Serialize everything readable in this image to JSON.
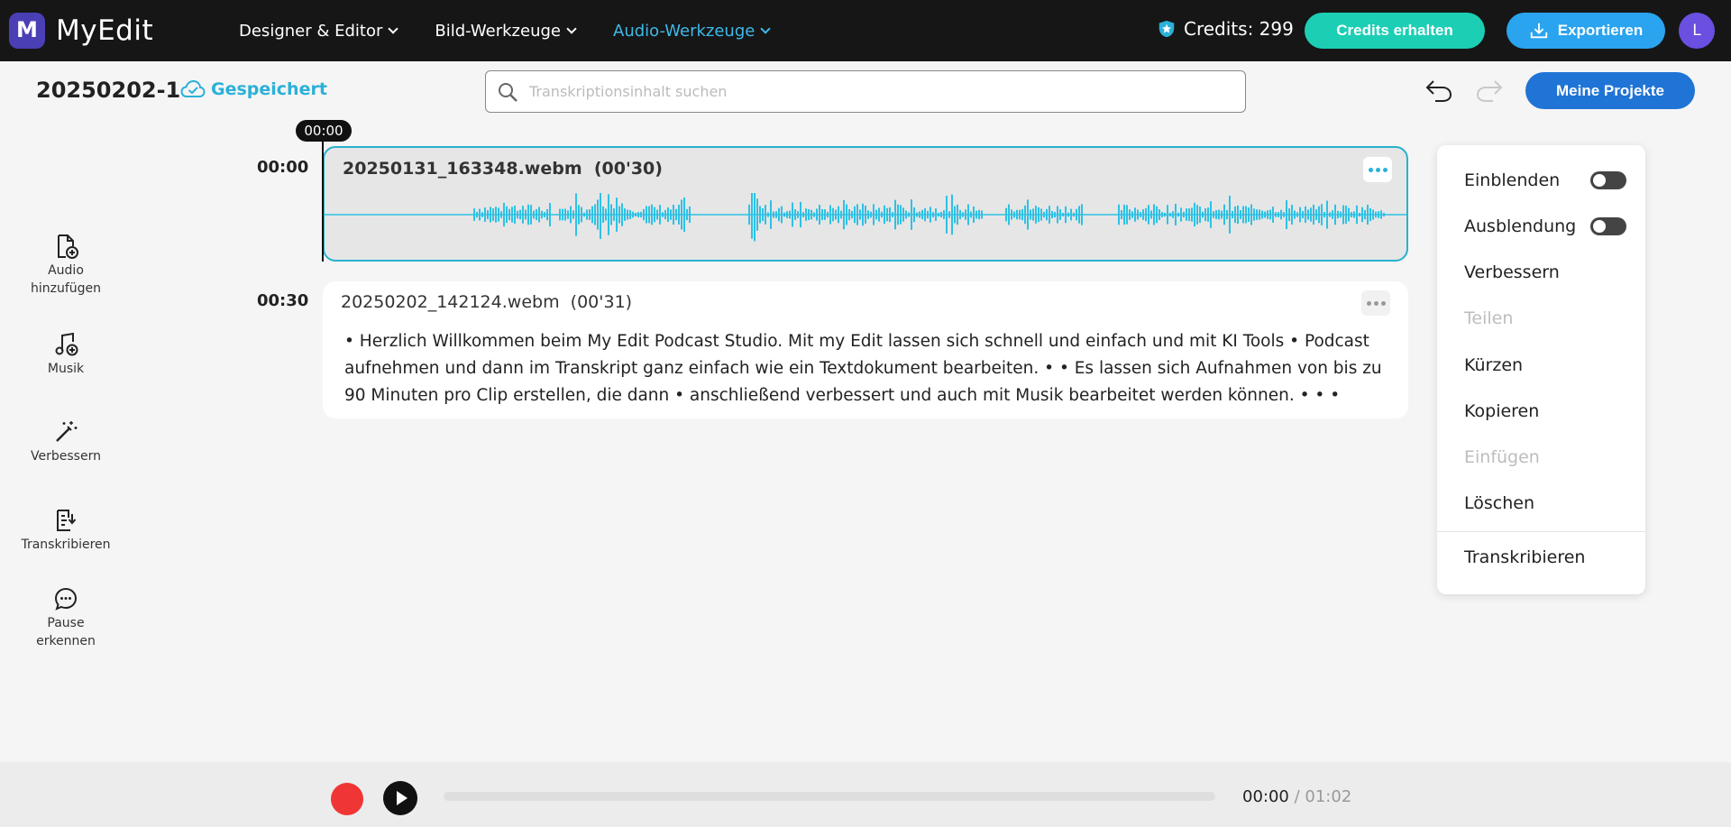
{
  "app": {
    "logo_letter": "M",
    "name": "MyEdit"
  },
  "nav": {
    "items": [
      {
        "label": "Designer & Editor"
      },
      {
        "label": "Bild-Werkzeuge"
      },
      {
        "label": "Audio-Werkzeuge",
        "active": true
      }
    ],
    "credits_label": "Credits: 299",
    "credits_button": "Credits erhalten",
    "export_button": "Exportieren",
    "avatar_letter": "L"
  },
  "project": {
    "title": "20250202-1",
    "status": "Gespeichert",
    "my_projects_button": "Meine Projekte"
  },
  "search": {
    "placeholder": "Transkriptionsinhalt suchen",
    "value": ""
  },
  "toolbar": {
    "items": [
      {
        "label": "Audio hinzufügen",
        "icon": "add-file-icon"
      },
      {
        "label": "Musik",
        "icon": "music-add-icon"
      },
      {
        "label": "Verbessern",
        "icon": "magic-wand-icon"
      },
      {
        "label": "Transkribieren",
        "icon": "transcribe-icon"
      },
      {
        "label": "Pause erkennen",
        "icon": "pause-bubble-icon"
      }
    ]
  },
  "timeline": {
    "playhead_time": "00:00",
    "clips": [
      {
        "start": "00:00",
        "name": "20250131_163348.webm",
        "duration": "(00'30)",
        "selected": true
      },
      {
        "start": "00:30",
        "name": "20250202_142124.webm",
        "duration": "(00'31)",
        "selected": false,
        "transcript": "•  Herzlich Willkommen beim My Edit Podcast Studio. Mit my Edit lassen sich schnell und einfach und mit KI Tools  •  Podcast aufnehmen und dann im Transkript ganz einfach wie ein Textdokument bearbeiten.  • •  Es lassen sich Aufnahmen von bis zu 90 Minuten pro Clip erstellen, die dann  •  anschließend verbessert und auch mit Musik bearbeitet werden können.  • • •"
      }
    ]
  },
  "context_menu": {
    "items": [
      {
        "label": "Einblenden",
        "toggle": true,
        "toggle_on": false
      },
      {
        "label": "Ausblendung",
        "toggle": true,
        "toggle_on": false
      },
      {
        "label": "Verbessern",
        "disabled": false
      },
      {
        "label": "Teilen",
        "disabled": true
      },
      {
        "label": "Kürzen",
        "disabled": false
      },
      {
        "label": "Kopieren",
        "disabled": false
      },
      {
        "label": "Einfügen",
        "disabled": true
      },
      {
        "label": "Löschen",
        "disabled": false
      },
      {
        "label": "Transkribieren",
        "disabled": false
      }
    ]
  },
  "player": {
    "current": "00:00",
    "total": "/ 01:02",
    "progress": 0
  },
  "colors": {
    "accent": "#27b1cf",
    "wave": "#2ec1e4",
    "record": "#f03535",
    "credits_button": "#1ccfb4",
    "export_button": "#2aa4ee",
    "projects_button": "#1f74d6"
  }
}
